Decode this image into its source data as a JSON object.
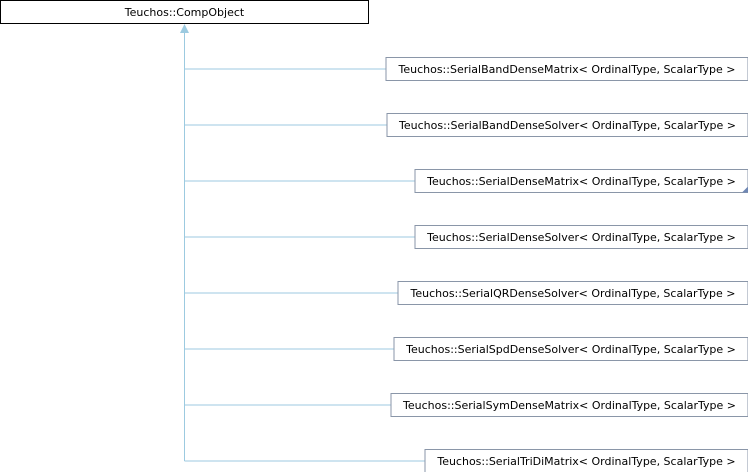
{
  "diagram": {
    "root": {
      "label": "Teuchos::CompObject"
    },
    "children": [
      {
        "label": "Teuchos::SerialBandDenseMatrix< OrdinalType, ScalarType >",
        "has_more": false
      },
      {
        "label": "Teuchos::SerialBandDenseSolver< OrdinalType, ScalarType >",
        "has_more": false
      },
      {
        "label": "Teuchos::SerialDenseMatrix< OrdinalType, ScalarType >",
        "has_more": true
      },
      {
        "label": "Teuchos::SerialDenseSolver< OrdinalType, ScalarType >",
        "has_more": false
      },
      {
        "label": "Teuchos::SerialQRDenseSolver< OrdinalType, ScalarType >",
        "has_more": false
      },
      {
        "label": "Teuchos::SerialSpdDenseSolver< OrdinalType, ScalarType >",
        "has_more": false
      },
      {
        "label": "Teuchos::SerialSymDenseMatrix< OrdinalType, ScalarType >",
        "has_more": false
      },
      {
        "label": "Teuchos::SerialTriDiMatrix< OrdinalType, ScalarType >",
        "has_more": false
      }
    ]
  }
}
